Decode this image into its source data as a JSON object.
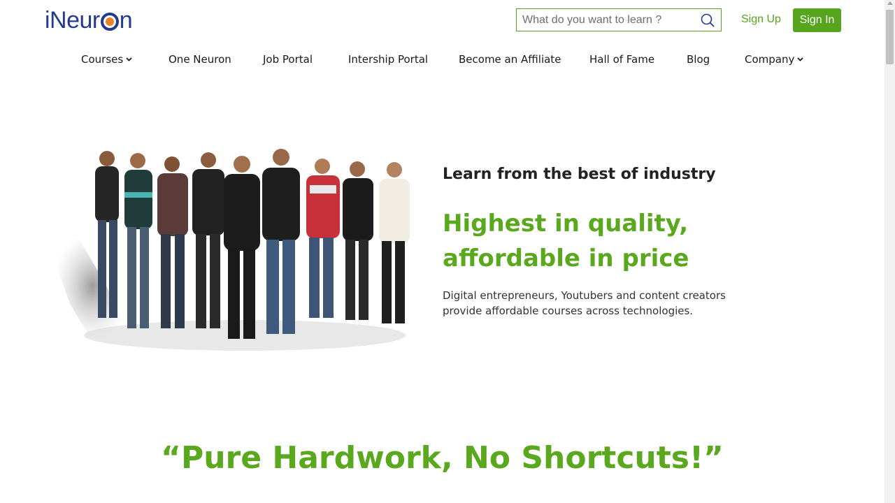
{
  "logo": {
    "text_prefix": "iNeur",
    "text_suffix": "n"
  },
  "search": {
    "placeholder": "What do you want to learn ?"
  },
  "auth": {
    "signup_label": "Sign Up",
    "signin_label": "Sign In"
  },
  "nav": {
    "items": [
      {
        "label": "Courses",
        "has_dropdown": true
      },
      {
        "label": "One Neuron"
      },
      {
        "label": "Job Portal"
      },
      {
        "label": "Intership Portal"
      },
      {
        "label": "Become an Affiliate"
      },
      {
        "label": "Hall of Fame"
      },
      {
        "label": "Blog"
      },
      {
        "label": "Company",
        "has_dropdown": true
      }
    ]
  },
  "hero": {
    "kicker": "Learn from the best of industry",
    "headline": "Highest in quality, affordable in price",
    "description": "Digital entrepreneurs, Youtubers and content creators provide affordable courses across technologies."
  },
  "quote": "“Pure Hardwork, No Shortcuts!”",
  "colors": {
    "brand_green": "#57a51e",
    "brand_blue": "#243a8f",
    "accent_orange": "#e8842a"
  }
}
